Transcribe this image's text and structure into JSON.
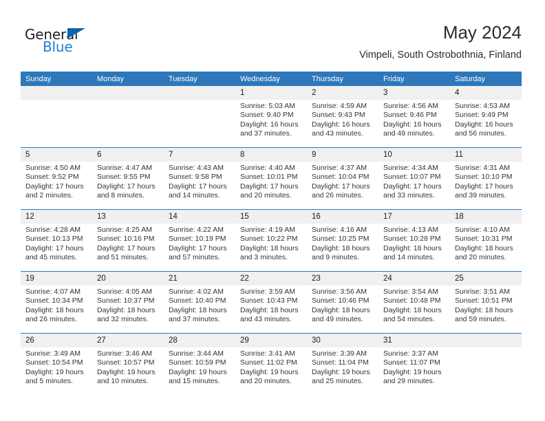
{
  "brand": {
    "name_part1": "General",
    "name_part2": "Blue",
    "triangle_color": "#1063a8",
    "blue_color": "#1f7fd0"
  },
  "header": {
    "title": "May 2024",
    "subtitle": "Vimpeli, South Ostrobothnia, Finland"
  },
  "theme": {
    "header_bg": "#2e77bb",
    "daynum_bg": "#f0f0f0",
    "grid_line": "#2e77bb"
  },
  "calendar": {
    "weekday_headers": [
      "Sunday",
      "Monday",
      "Tuesday",
      "Wednesday",
      "Thursday",
      "Friday",
      "Saturday"
    ],
    "weeks": [
      [
        {
          "day": "",
          "blank": true
        },
        {
          "day": "",
          "blank": true
        },
        {
          "day": "",
          "blank": true
        },
        {
          "day": "1",
          "sunrise": "Sunrise: 5:03 AM",
          "sunset": "Sunset: 9:40 PM",
          "daylight": "Daylight: 16 hours and 37 minutes."
        },
        {
          "day": "2",
          "sunrise": "Sunrise: 4:59 AM",
          "sunset": "Sunset: 9:43 PM",
          "daylight": "Daylight: 16 hours and 43 minutes."
        },
        {
          "day": "3",
          "sunrise": "Sunrise: 4:56 AM",
          "sunset": "Sunset: 9:46 PM",
          "daylight": "Daylight: 16 hours and 49 minutes."
        },
        {
          "day": "4",
          "sunrise": "Sunrise: 4:53 AM",
          "sunset": "Sunset: 9:49 PM",
          "daylight": "Daylight: 16 hours and 56 minutes."
        }
      ],
      [
        {
          "day": "5",
          "sunrise": "Sunrise: 4:50 AM",
          "sunset": "Sunset: 9:52 PM",
          "daylight": "Daylight: 17 hours and 2 minutes."
        },
        {
          "day": "6",
          "sunrise": "Sunrise: 4:47 AM",
          "sunset": "Sunset: 9:55 PM",
          "daylight": "Daylight: 17 hours and 8 minutes."
        },
        {
          "day": "7",
          "sunrise": "Sunrise: 4:43 AM",
          "sunset": "Sunset: 9:58 PM",
          "daylight": "Daylight: 17 hours and 14 minutes."
        },
        {
          "day": "8",
          "sunrise": "Sunrise: 4:40 AM",
          "sunset": "Sunset: 10:01 PM",
          "daylight": "Daylight: 17 hours and 20 minutes."
        },
        {
          "day": "9",
          "sunrise": "Sunrise: 4:37 AM",
          "sunset": "Sunset: 10:04 PM",
          "daylight": "Daylight: 17 hours and 26 minutes."
        },
        {
          "day": "10",
          "sunrise": "Sunrise: 4:34 AM",
          "sunset": "Sunset: 10:07 PM",
          "daylight": "Daylight: 17 hours and 33 minutes."
        },
        {
          "day": "11",
          "sunrise": "Sunrise: 4:31 AM",
          "sunset": "Sunset: 10:10 PM",
          "daylight": "Daylight: 17 hours and 39 minutes."
        }
      ],
      [
        {
          "day": "12",
          "sunrise": "Sunrise: 4:28 AM",
          "sunset": "Sunset: 10:13 PM",
          "daylight": "Daylight: 17 hours and 45 minutes."
        },
        {
          "day": "13",
          "sunrise": "Sunrise: 4:25 AM",
          "sunset": "Sunset: 10:16 PM",
          "daylight": "Daylight: 17 hours and 51 minutes."
        },
        {
          "day": "14",
          "sunrise": "Sunrise: 4:22 AM",
          "sunset": "Sunset: 10:19 PM",
          "daylight": "Daylight: 17 hours and 57 minutes."
        },
        {
          "day": "15",
          "sunrise": "Sunrise: 4:19 AM",
          "sunset": "Sunset: 10:22 PM",
          "daylight": "Daylight: 18 hours and 3 minutes."
        },
        {
          "day": "16",
          "sunrise": "Sunrise: 4:16 AM",
          "sunset": "Sunset: 10:25 PM",
          "daylight": "Daylight: 18 hours and 9 minutes."
        },
        {
          "day": "17",
          "sunrise": "Sunrise: 4:13 AM",
          "sunset": "Sunset: 10:28 PM",
          "daylight": "Daylight: 18 hours and 14 minutes."
        },
        {
          "day": "18",
          "sunrise": "Sunrise: 4:10 AM",
          "sunset": "Sunset: 10:31 PM",
          "daylight": "Daylight: 18 hours and 20 minutes."
        }
      ],
      [
        {
          "day": "19",
          "sunrise": "Sunrise: 4:07 AM",
          "sunset": "Sunset: 10:34 PM",
          "daylight": "Daylight: 18 hours and 26 minutes."
        },
        {
          "day": "20",
          "sunrise": "Sunrise: 4:05 AM",
          "sunset": "Sunset: 10:37 PM",
          "daylight": "Daylight: 18 hours and 32 minutes."
        },
        {
          "day": "21",
          "sunrise": "Sunrise: 4:02 AM",
          "sunset": "Sunset: 10:40 PM",
          "daylight": "Daylight: 18 hours and 37 minutes."
        },
        {
          "day": "22",
          "sunrise": "Sunrise: 3:59 AM",
          "sunset": "Sunset: 10:43 PM",
          "daylight": "Daylight: 18 hours and 43 minutes."
        },
        {
          "day": "23",
          "sunrise": "Sunrise: 3:56 AM",
          "sunset": "Sunset: 10:46 PM",
          "daylight": "Daylight: 18 hours and 49 minutes."
        },
        {
          "day": "24",
          "sunrise": "Sunrise: 3:54 AM",
          "sunset": "Sunset: 10:48 PM",
          "daylight": "Daylight: 18 hours and 54 minutes."
        },
        {
          "day": "25",
          "sunrise": "Sunrise: 3:51 AM",
          "sunset": "Sunset: 10:51 PM",
          "daylight": "Daylight: 18 hours and 59 minutes."
        }
      ],
      [
        {
          "day": "26",
          "sunrise": "Sunrise: 3:49 AM",
          "sunset": "Sunset: 10:54 PM",
          "daylight": "Daylight: 19 hours and 5 minutes."
        },
        {
          "day": "27",
          "sunrise": "Sunrise: 3:46 AM",
          "sunset": "Sunset: 10:57 PM",
          "daylight": "Daylight: 19 hours and 10 minutes."
        },
        {
          "day": "28",
          "sunrise": "Sunrise: 3:44 AM",
          "sunset": "Sunset: 10:59 PM",
          "daylight": "Daylight: 19 hours and 15 minutes."
        },
        {
          "day": "29",
          "sunrise": "Sunrise: 3:41 AM",
          "sunset": "Sunset: 11:02 PM",
          "daylight": "Daylight: 19 hours and 20 minutes."
        },
        {
          "day": "30",
          "sunrise": "Sunrise: 3:39 AM",
          "sunset": "Sunset: 11:04 PM",
          "daylight": "Daylight: 19 hours and 25 minutes."
        },
        {
          "day": "31",
          "sunrise": "Sunrise: 3:37 AM",
          "sunset": "Sunset: 11:07 PM",
          "daylight": "Daylight: 19 hours and 29 minutes."
        },
        {
          "day": "",
          "blank": true
        }
      ]
    ]
  }
}
